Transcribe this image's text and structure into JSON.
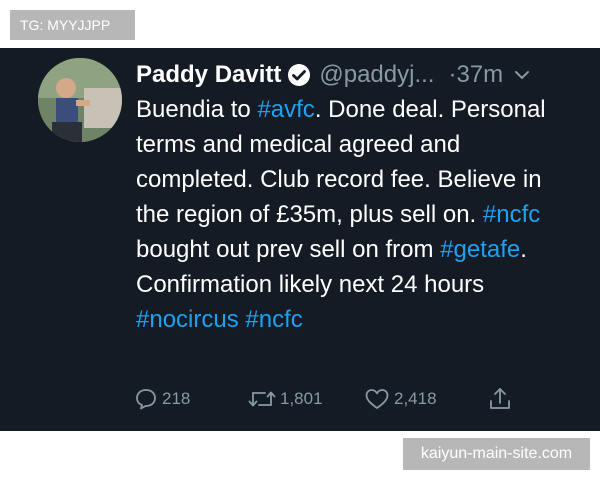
{
  "watermark_top": "TG: MYYJJPP",
  "watermark_bottom": "kaiyun-main-site.com",
  "tweet": {
    "author_name": "Paddy Davitt",
    "verified_icon": "verified-badge-icon",
    "handle": "@paddyj...",
    "time": "·37m",
    "body": [
      {
        "t": "Buendia to "
      },
      {
        "t": "#avfc",
        "tag": true
      },
      {
        "t": ". Done deal. Personal terms and medical agreed and completed. Club record fee. Believe in the region of £35m, plus sell on. "
      },
      {
        "t": "#ncfc",
        "tag": true
      },
      {
        "t": " bought out prev sell on from "
      },
      {
        "t": "#getafe",
        "tag": true
      },
      {
        "t": ". Confirmation likely next 24 hours "
      },
      {
        "t": "#nocircus",
        "tag": true
      },
      {
        "t": " "
      },
      {
        "t": "#ncfc",
        "tag": true
      }
    ],
    "actions": {
      "replies": "218",
      "retweets": "1,801",
      "likes": "2,418"
    }
  },
  "colors": {
    "background": "#141b24",
    "hashtag": "#1da1f2",
    "muted": "#8899a6"
  }
}
